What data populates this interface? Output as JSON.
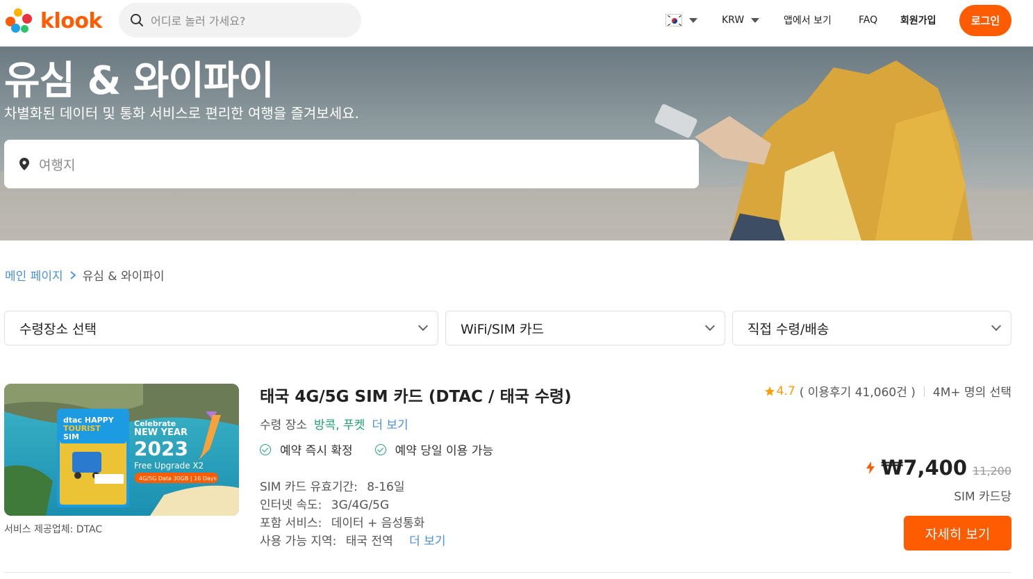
{
  "brand": {
    "name": "klook",
    "color": "#ff5b00"
  },
  "header": {
    "search_placeholder": "어디로 놀러 가세요?",
    "currency": "KRW",
    "app_link": "앱에서 보기",
    "faq": "FAQ",
    "signup": "회원가입",
    "login": "로그인",
    "locale_flag": "korea-flag-icon"
  },
  "hero": {
    "title": "유심 & 와이파이",
    "subtitle": "차별화된 데이터 및 통화 서비스로 편리한 여행을 즐겨보세요.",
    "search_placeholder": "여행지"
  },
  "breadcrumb": {
    "home": "메인 페이지",
    "current": "유심 & 와이파이"
  },
  "filters": [
    "수령장소 선택",
    "WiFi/SIM 카드",
    "직접 수령/배송"
  ],
  "product": {
    "title": "태국 4G/5G SIM 카드 (DTAC / 태국 수령)",
    "provider": "서비스 제공업체: DTAC",
    "location_label": "수령 장소",
    "location_value": "방콕, 푸켓",
    "more": "더 보기",
    "badges": [
      "예약 즉시 확정",
      "예약 당일 이용 가능"
    ],
    "specs": [
      {
        "label": "SIM 카드 유효기간:",
        "value": "8-16일"
      },
      {
        "label": "인터넷 속도:",
        "value": "3G/4G/5G"
      },
      {
        "label": "포함 서비스:",
        "value": "데이터 + 음성통화"
      },
      {
        "label": "사용 가능 지역:",
        "value": "태국 전역"
      }
    ],
    "rating": "4.7",
    "reviews": "( 이용후기 41,060건 )",
    "booked": "4M+ 명의 선택",
    "price": "₩7,400",
    "old_price": "11,200",
    "price_unit": "SIM 카드당",
    "cta": "자세히 보기",
    "thumb_text": {
      "brand": "dtac HAPPY",
      "tourist": "TOURIST",
      "sim": "SIM",
      "celebrate": "Celebrate",
      "new_year": "NEW YEAR",
      "year": "2023",
      "upgrade": "Free Upgrade X2",
      "data": "4G/5G Data 30GB | 16 Days"
    }
  },
  "colors": {
    "accent": "#ff5b00",
    "link": "#4a8fe0",
    "green": "#1ea36b",
    "star": "#ff9d00"
  }
}
